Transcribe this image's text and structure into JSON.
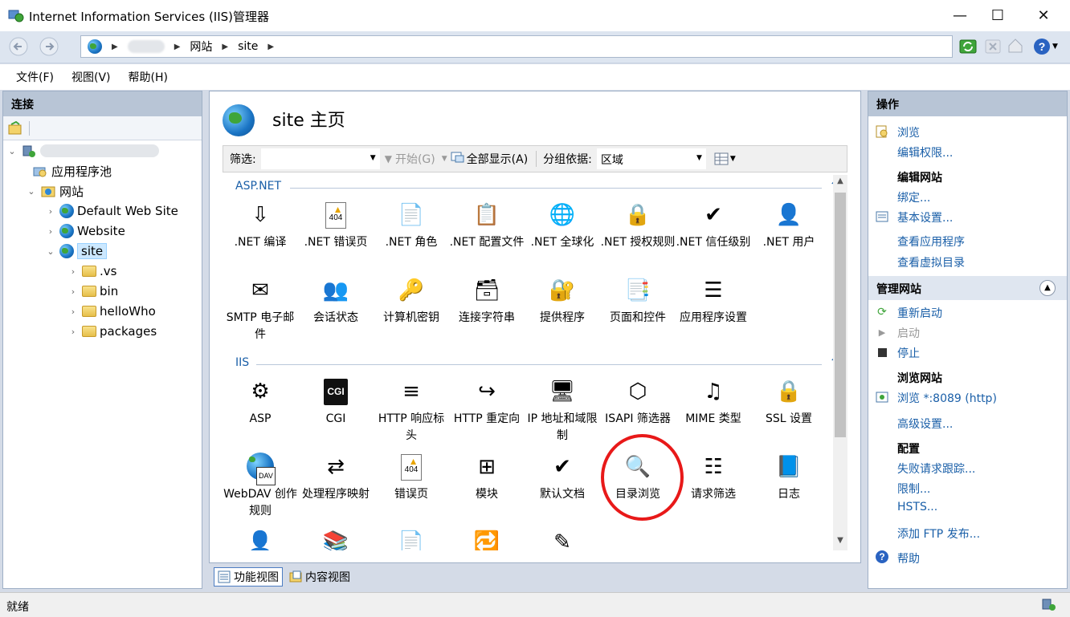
{
  "window": {
    "title": "Internet Information Services (IIS)管理器",
    "controls": {
      "minimize": "—",
      "maximize": "☐",
      "close": "✕"
    }
  },
  "address": {
    "crumbs": [
      "网站",
      "site"
    ]
  },
  "menu": {
    "file": "文件(F)",
    "view": "视图(V)",
    "help": "帮助(H)"
  },
  "left": {
    "header": "连接",
    "tree": {
      "app_pools": "应用程序池",
      "sites": "网站",
      "default_site": "Default Web Site",
      "website": "Website",
      "site": "site",
      "vs": ".vs",
      "bin": "bin",
      "hellowho": "helloWho",
      "packages": "packages"
    }
  },
  "center": {
    "title": "site 主页",
    "filter": {
      "label": "筛选:",
      "start": "开始(G)",
      "show_all": "全部显示(A)",
      "group_by": "分组依据:",
      "group_value": "区域"
    },
    "groups": {
      "aspnet": "ASP.NET",
      "iis": "IIS"
    },
    "aspnet_features": [
      ".NET 编译",
      ".NET 错误页",
      ".NET 角色",
      ".NET 配置文件",
      ".NET 全球化",
      ".NET 授权规则",
      ".NET 信任级别",
      ".NET 用户",
      "SMTP 电子邮件",
      "会话状态",
      "计算机密钥",
      "连接字符串",
      "提供程序",
      "页面和控件",
      "应用程序设置"
    ],
    "iis_features": [
      "ASP",
      "CGI",
      "HTTP 响应标头",
      "HTTP 重定向",
      "IP 地址和域限制",
      "ISAPI 筛选器",
      "MIME 类型",
      "SSL 设置",
      "WebDAV 创作规则",
      "处理程序映射",
      "错误页",
      "模块",
      "默认文档",
      "目录浏览",
      "请求筛选",
      "日志"
    ],
    "icon_cgi": "CGI",
    "icon_404": "404",
    "view_tabs": {
      "features": "功能视图",
      "content": "内容视图"
    }
  },
  "right": {
    "header": "操作",
    "browse": "浏览",
    "edit_perms": "编辑权限...",
    "edit_site_hdr": "编辑网站",
    "bindings": "绑定...",
    "basic_settings": "基本设置...",
    "view_apps": "查看应用程序",
    "view_vdirs": "查看虚拟目录",
    "manage_site_hdr": "管理网站",
    "restart": "重新启动",
    "start": "启动",
    "stop": "停止",
    "browse_site_hdr": "浏览网站",
    "browse_port": "浏览 *:8089 (http)",
    "advanced": "高级设置...",
    "config_hdr": "配置",
    "failed_req": "失败请求跟踪...",
    "limits": "限制...",
    "hsts": "HSTS...",
    "add_ftp": "添加 FTP 发布...",
    "help": "帮助"
  },
  "status": {
    "text": "就绪"
  },
  "colors": {
    "link": "#1a5fa8",
    "highlight": "#e81919",
    "panel_header": "#b8c5d6"
  }
}
